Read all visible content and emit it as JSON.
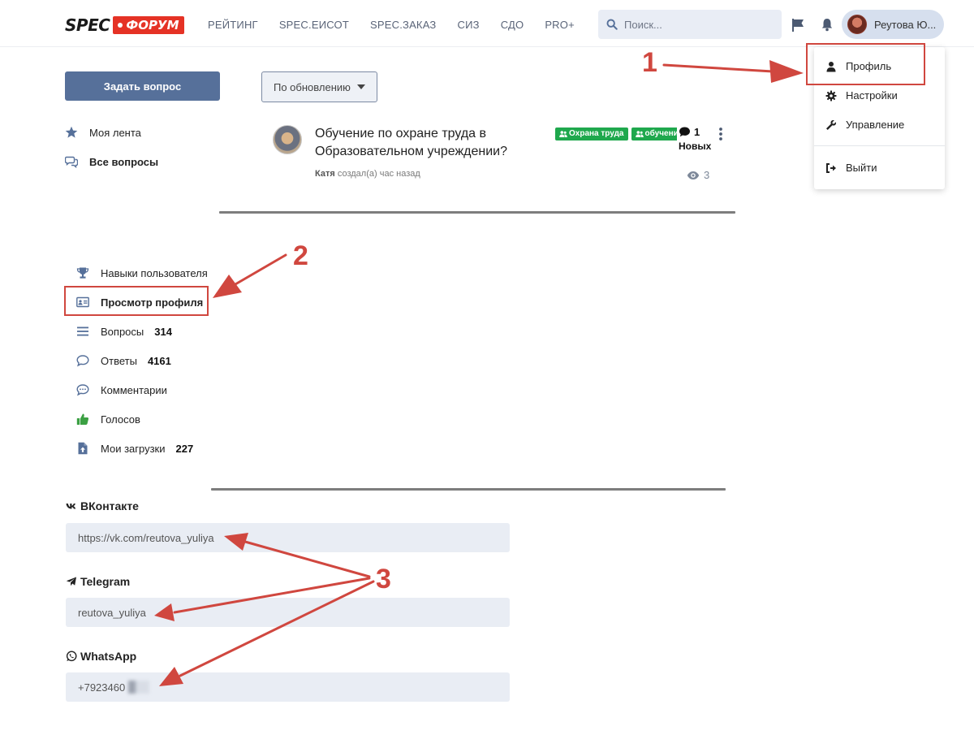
{
  "header": {
    "logo": {
      "spec": "SPEC",
      "forum": "ФОРУМ"
    },
    "nav": [
      "РЕЙТИНГ",
      "SPEC.ЕИСОТ",
      "SPEC.ЗАКАЗ",
      "СИЗ",
      "СДО",
      "PRO+"
    ],
    "search_placeholder": "Поиск...",
    "user_name": "Реутова Ю..."
  },
  "user_menu": {
    "items": [
      {
        "label": "Профиль",
        "icon": "user-icon"
      },
      {
        "label": "Настройки",
        "icon": "gear-icon"
      },
      {
        "label": "Управление",
        "icon": "wrench-icon"
      },
      {
        "label": "Выйти",
        "icon": "sign-out-icon"
      }
    ]
  },
  "main": {
    "ask_button": "Задать вопрос",
    "sort_label": "По обновлению",
    "sidebar": [
      {
        "label": "Моя лента",
        "icon": "star-icon",
        "active": false
      },
      {
        "label": "Все вопросы",
        "icon": "chat-bubbles-icon",
        "active": true
      }
    ],
    "question": {
      "title": "Обучение по охране труда в Образовательном учреждении?",
      "author": "Катя",
      "meta": "создал(а) час назад",
      "tags": [
        "Охрана труда",
        "обучение"
      ],
      "comments_count": "1",
      "comments_label": "Новых",
      "views": "3"
    }
  },
  "profile_menu": {
    "items": [
      {
        "label": "Навыки пользователя",
        "icon": "trophy-icon",
        "count": ""
      },
      {
        "label": "Просмотр профиля",
        "icon": "id-card-icon",
        "count": ""
      },
      {
        "label": "Вопросы",
        "icon": "list-icon",
        "count": "314"
      },
      {
        "label": "Ответы",
        "icon": "comment-icon",
        "count": "4161"
      },
      {
        "label": "Комментарии",
        "icon": "comment-dots-icon",
        "count": ""
      },
      {
        "label": "Голосов",
        "icon": "thumbs-up-icon",
        "count": ""
      },
      {
        "label": "Мои загрузки",
        "icon": "file-upload-icon",
        "count": "227"
      }
    ]
  },
  "socials": {
    "vk": {
      "label": "ВКонтакте",
      "value": "https://vk.com/reutova_yuliya"
    },
    "telegram": {
      "label": "Telegram",
      "value": "reutova_yuliya"
    },
    "whatsapp": {
      "label": "WhatsApp",
      "value": "+7923460"
    }
  },
  "annotations": {
    "one": "1",
    "two": "2",
    "three": "3"
  },
  "colors": {
    "primary": "#56709a",
    "tag_green": "#1fa84d",
    "annotation_red": "#d0473f",
    "logo_red": "#e53225"
  }
}
